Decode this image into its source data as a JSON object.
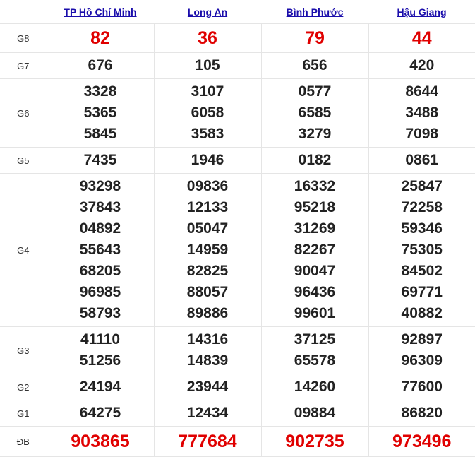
{
  "provinces": [
    "TP Hồ Chí Minh",
    "Long An",
    "Bình Phước",
    "Hậu Giang"
  ],
  "rows": [
    {
      "label": "G8",
      "results": [
        [
          "82"
        ],
        [
          "36"
        ],
        [
          "79"
        ],
        [
          "44"
        ]
      ]
    },
    {
      "label": "G7",
      "results": [
        [
          "676"
        ],
        [
          "105"
        ],
        [
          "656"
        ],
        [
          "420"
        ]
      ]
    },
    {
      "label": "G6",
      "results": [
        [
          "3328",
          "5365",
          "5845"
        ],
        [
          "3107",
          "6058",
          "3583"
        ],
        [
          "0577",
          "6585",
          "3279"
        ],
        [
          "8644",
          "3488",
          "7098"
        ]
      ]
    },
    {
      "label": "G5",
      "results": [
        [
          "7435"
        ],
        [
          "1946"
        ],
        [
          "0182"
        ],
        [
          "0861"
        ]
      ]
    },
    {
      "label": "G4",
      "results": [
        [
          "93298",
          "37843",
          "04892",
          "55643",
          "68205",
          "96985",
          "58793"
        ],
        [
          "09836",
          "12133",
          "05047",
          "14959",
          "82825",
          "88057",
          "89886"
        ],
        [
          "16332",
          "95218",
          "31269",
          "82267",
          "90047",
          "96436",
          "99601"
        ],
        [
          "25847",
          "72258",
          "59346",
          "75305",
          "84502",
          "69771",
          "40882"
        ]
      ]
    },
    {
      "label": "G3",
      "results": [
        [
          "41110",
          "51256"
        ],
        [
          "14316",
          "14839"
        ],
        [
          "37125",
          "65578"
        ],
        [
          "92897",
          "96309"
        ]
      ]
    },
    {
      "label": "G2",
      "results": [
        [
          "24194"
        ],
        [
          "23944"
        ],
        [
          "14260"
        ],
        [
          "77600"
        ]
      ]
    },
    {
      "label": "G1",
      "results": [
        [
          "64275"
        ],
        [
          "12434"
        ],
        [
          "09884"
        ],
        [
          "86820"
        ]
      ]
    },
    {
      "label": "ĐB",
      "results": [
        [
          "903865"
        ],
        [
          "777684"
        ],
        [
          "902735"
        ],
        [
          "973496"
        ]
      ]
    }
  ],
  "colors": {
    "highlight": "#e00000",
    "link": "#1a0dab",
    "text": "#222222",
    "border": "#e5e5e5"
  }
}
